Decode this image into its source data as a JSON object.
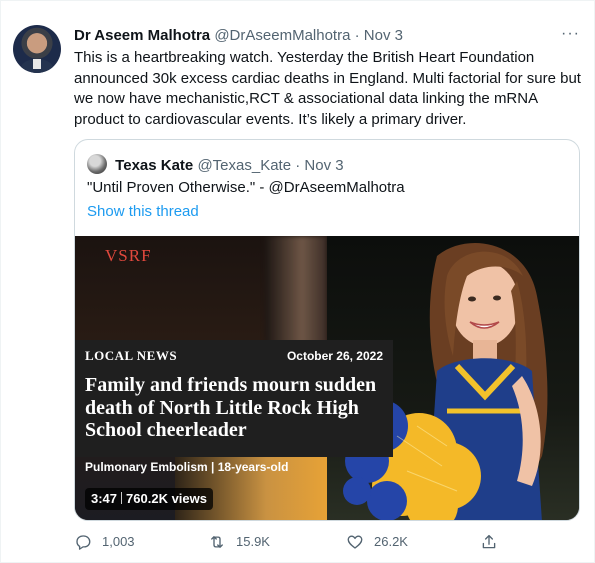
{
  "tweet": {
    "author_name": "Dr Aseem Malhotra",
    "author_handle": "@DrAseemMalhotra",
    "separator": "·",
    "date": "Nov 3",
    "more_label": "···",
    "text": "This is a heartbreaking watch. Yesterday the British Heart Foundation announced 30k excess cardiac deaths in England. Multi factorial for sure but we now have mechanistic,RCT & associational data linking the mRNA product to cardiovascular events. It’s likely a primary driver."
  },
  "quote": {
    "author_name": "Texas Kate",
    "author_handle": "@Texas_Kate",
    "separator": "·",
    "date": "Nov 3",
    "text": "\"Until Proven Otherwise.\" - @DrAseemMalhotra",
    "thread_link": "Show this thread",
    "media": {
      "brand": "VSRF",
      "section": "LOCAL NEWS",
      "date": "October 26, 2022",
      "headline": "Family and friends mourn sudden death of North Little Rock High School cheerleader",
      "subline": "Pulmonary Embolism | 18-years-old",
      "duration": "3:47",
      "views": "760.2K views"
    }
  },
  "actions": {
    "replies": "1,003",
    "retweets": "15.9K",
    "likes": "26.2K"
  },
  "colors": {
    "link": "#1d9bf0",
    "muted": "#536471",
    "brand_red": "#e0483d"
  }
}
